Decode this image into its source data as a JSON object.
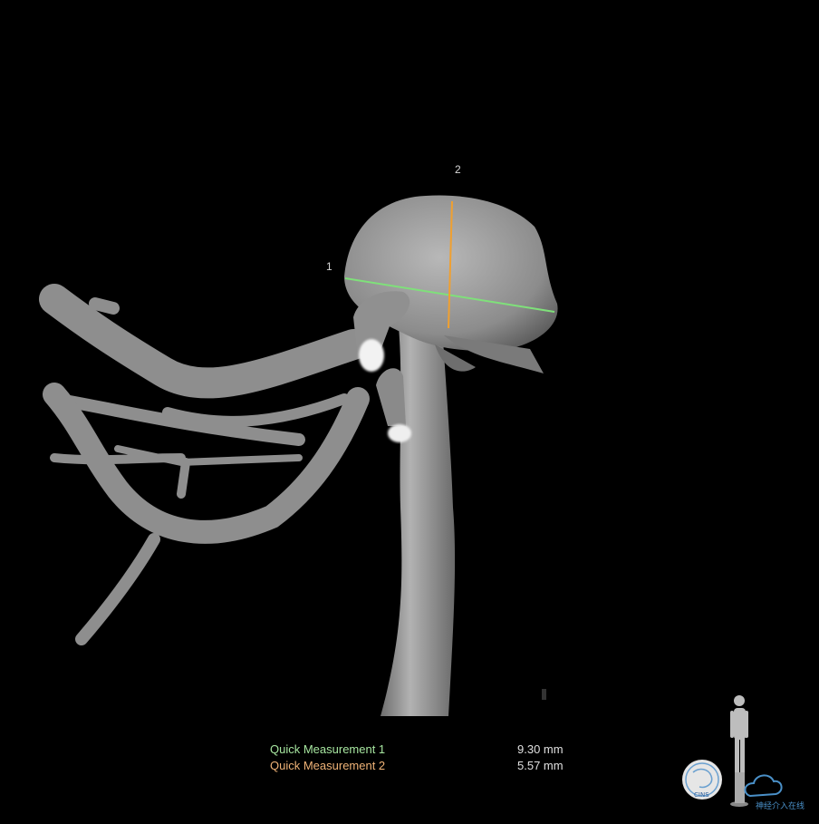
{
  "viewer": {
    "background": "#000000",
    "vessel_color": "#a9a9a9",
    "measure_line_labels": [
      "1",
      "2"
    ],
    "measurements": [
      {
        "label": "Quick Measurement 1",
        "value": "9.30 mm",
        "color": "#7fe07a"
      },
      {
        "label": "Quick Measurement 2",
        "value": "5.57 mm",
        "color": "#f0a030"
      }
    ],
    "orientation_icon": "human-figure-orientation-icon",
    "watermark_logos": [
      {
        "icon": "cins-logo-seal",
        "text": "CINS"
      },
      {
        "icon": "neurointervention-online-logo",
        "text": "神经介入在线"
      }
    ]
  }
}
